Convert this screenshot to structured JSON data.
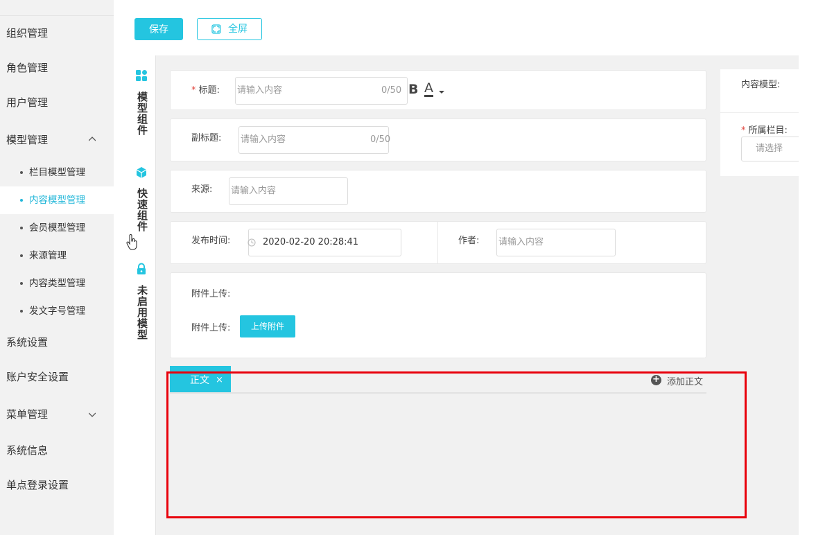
{
  "sidebar": {
    "items": [
      {
        "label": "组织管理"
      },
      {
        "label": "角色管理"
      },
      {
        "label": "用户管理"
      },
      {
        "label": "模型管理"
      },
      {
        "label": "系统设置"
      },
      {
        "label": "账户安全设置"
      },
      {
        "label": "菜单管理"
      },
      {
        "label": "系统信息"
      },
      {
        "label": "单点登录设置"
      }
    ],
    "model_sub": [
      {
        "label": "栏目模型管理",
        "active": false
      },
      {
        "label": "内容模型管理",
        "active": true
      },
      {
        "label": "会员模型管理",
        "active": false
      },
      {
        "label": "来源管理",
        "active": false
      },
      {
        "label": "内容类型管理",
        "active": false
      },
      {
        "label": "发文字号管理",
        "active": false
      }
    ]
  },
  "toolbar": {
    "save_label": "保存",
    "fullscreen_label": "全屏"
  },
  "palette": {
    "groups": [
      {
        "label": "模型组件",
        "icon": "grid-icon"
      },
      {
        "label": "快速组件",
        "icon": "cube-icon"
      },
      {
        "label": "未启用模型",
        "icon": "lock-icon"
      }
    ]
  },
  "form": {
    "title": {
      "label": "标题:",
      "required_mark": "*",
      "placeholder": "请输入内容",
      "count": "0/50"
    },
    "subtitle": {
      "label": "副标题:",
      "placeholder": "请输入内容",
      "count": "0/50"
    },
    "source": {
      "label": "来源:",
      "placeholder": "请输入内容"
    },
    "publish_time": {
      "label": "发布时间:",
      "value": "2020-02-20 20:28:41"
    },
    "author": {
      "label": "作者:",
      "placeholder": "请输入内容"
    },
    "attachment": {
      "label1": "附件上传:",
      "label2": "附件上传:",
      "upload_button": "上传附件"
    }
  },
  "body_tabs": {
    "tab_label": "正文",
    "close": "×",
    "add_label": "添加正文",
    "add_icon": "+"
  },
  "right_panel": {
    "content_model_label": "内容模型:",
    "column_label": "所属栏目:",
    "column_required_mark": "*",
    "column_placeholder": "请选择"
  },
  "colors": {
    "accent": "#24c5e0",
    "highlight": "#e8000b",
    "required": "#e0423a"
  }
}
